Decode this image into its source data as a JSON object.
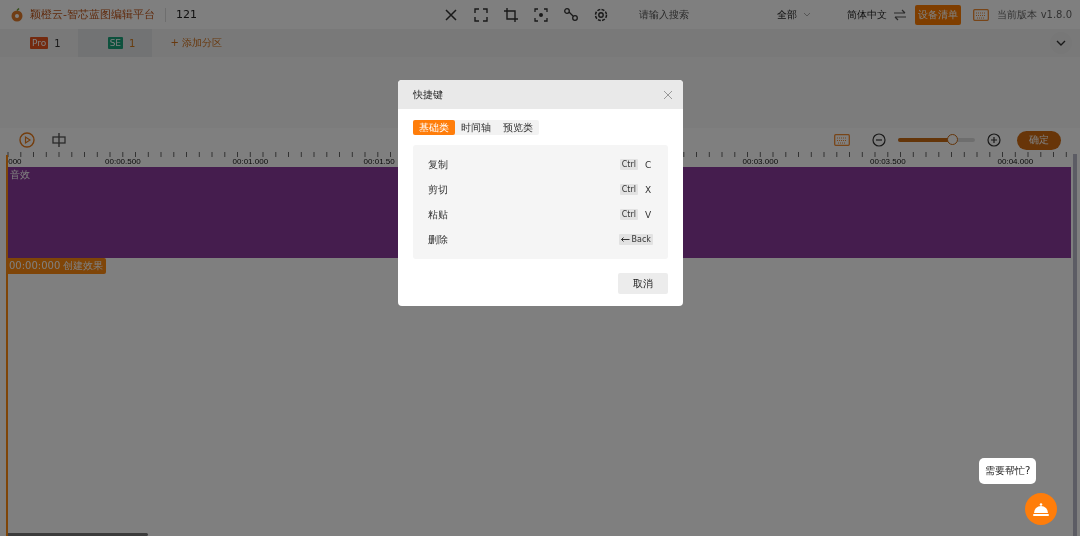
{
  "header": {
    "app_name": "颖橙云-智芯蓝图编辑平台",
    "project_name": "121",
    "search": {
      "placeholder": "请输入搜索"
    },
    "filter": "全部",
    "language": "简体中文",
    "device_list_button": "设备清单",
    "version": "当前版本 v1.8.0"
  },
  "partition_tabs": [
    {
      "kind": "pro",
      "badge": "Pro",
      "count": "1",
      "selected": false
    },
    {
      "kind": "se",
      "badge": "SE",
      "count": "1",
      "selected": true
    }
  ],
  "add_partition": "+ 添加分区",
  "timeline": {
    "zoom": {
      "level": 0.7
    },
    "confirm_button": "确定",
    "ruler_labels": [
      ".000",
      "00:00.500",
      "00:01.000",
      "00:01.50",
      "00:03.000",
      "00:03.500",
      "00:04.000"
    ],
    "track": {
      "label": "音效"
    },
    "effect_label": "00:00:000 创建效果"
  },
  "dialog": {
    "title": "快捷键",
    "tabs": [
      {
        "label": "基础类",
        "selected": true
      },
      {
        "label": "时间轴",
        "selected": false
      },
      {
        "label": "预览类",
        "selected": false
      }
    ],
    "shortcuts": [
      {
        "action": "复制",
        "keys": [
          {
            "kind": "key",
            "label": "Ctrl"
          },
          {
            "kind": "char",
            "label": "C"
          }
        ]
      },
      {
        "action": "剪切",
        "keys": [
          {
            "kind": "key",
            "label": "Ctrl"
          },
          {
            "kind": "char",
            "label": "X"
          }
        ]
      },
      {
        "action": "粘贴",
        "keys": [
          {
            "kind": "key",
            "label": "Ctrl"
          },
          {
            "kind": "char",
            "label": "V"
          }
        ]
      },
      {
        "action": "删除",
        "keys": [
          {
            "kind": "back",
            "label": "Back"
          }
        ]
      }
    ],
    "cancel_button": "取消"
  },
  "help": {
    "bubble": "需要帮忙?"
  }
}
